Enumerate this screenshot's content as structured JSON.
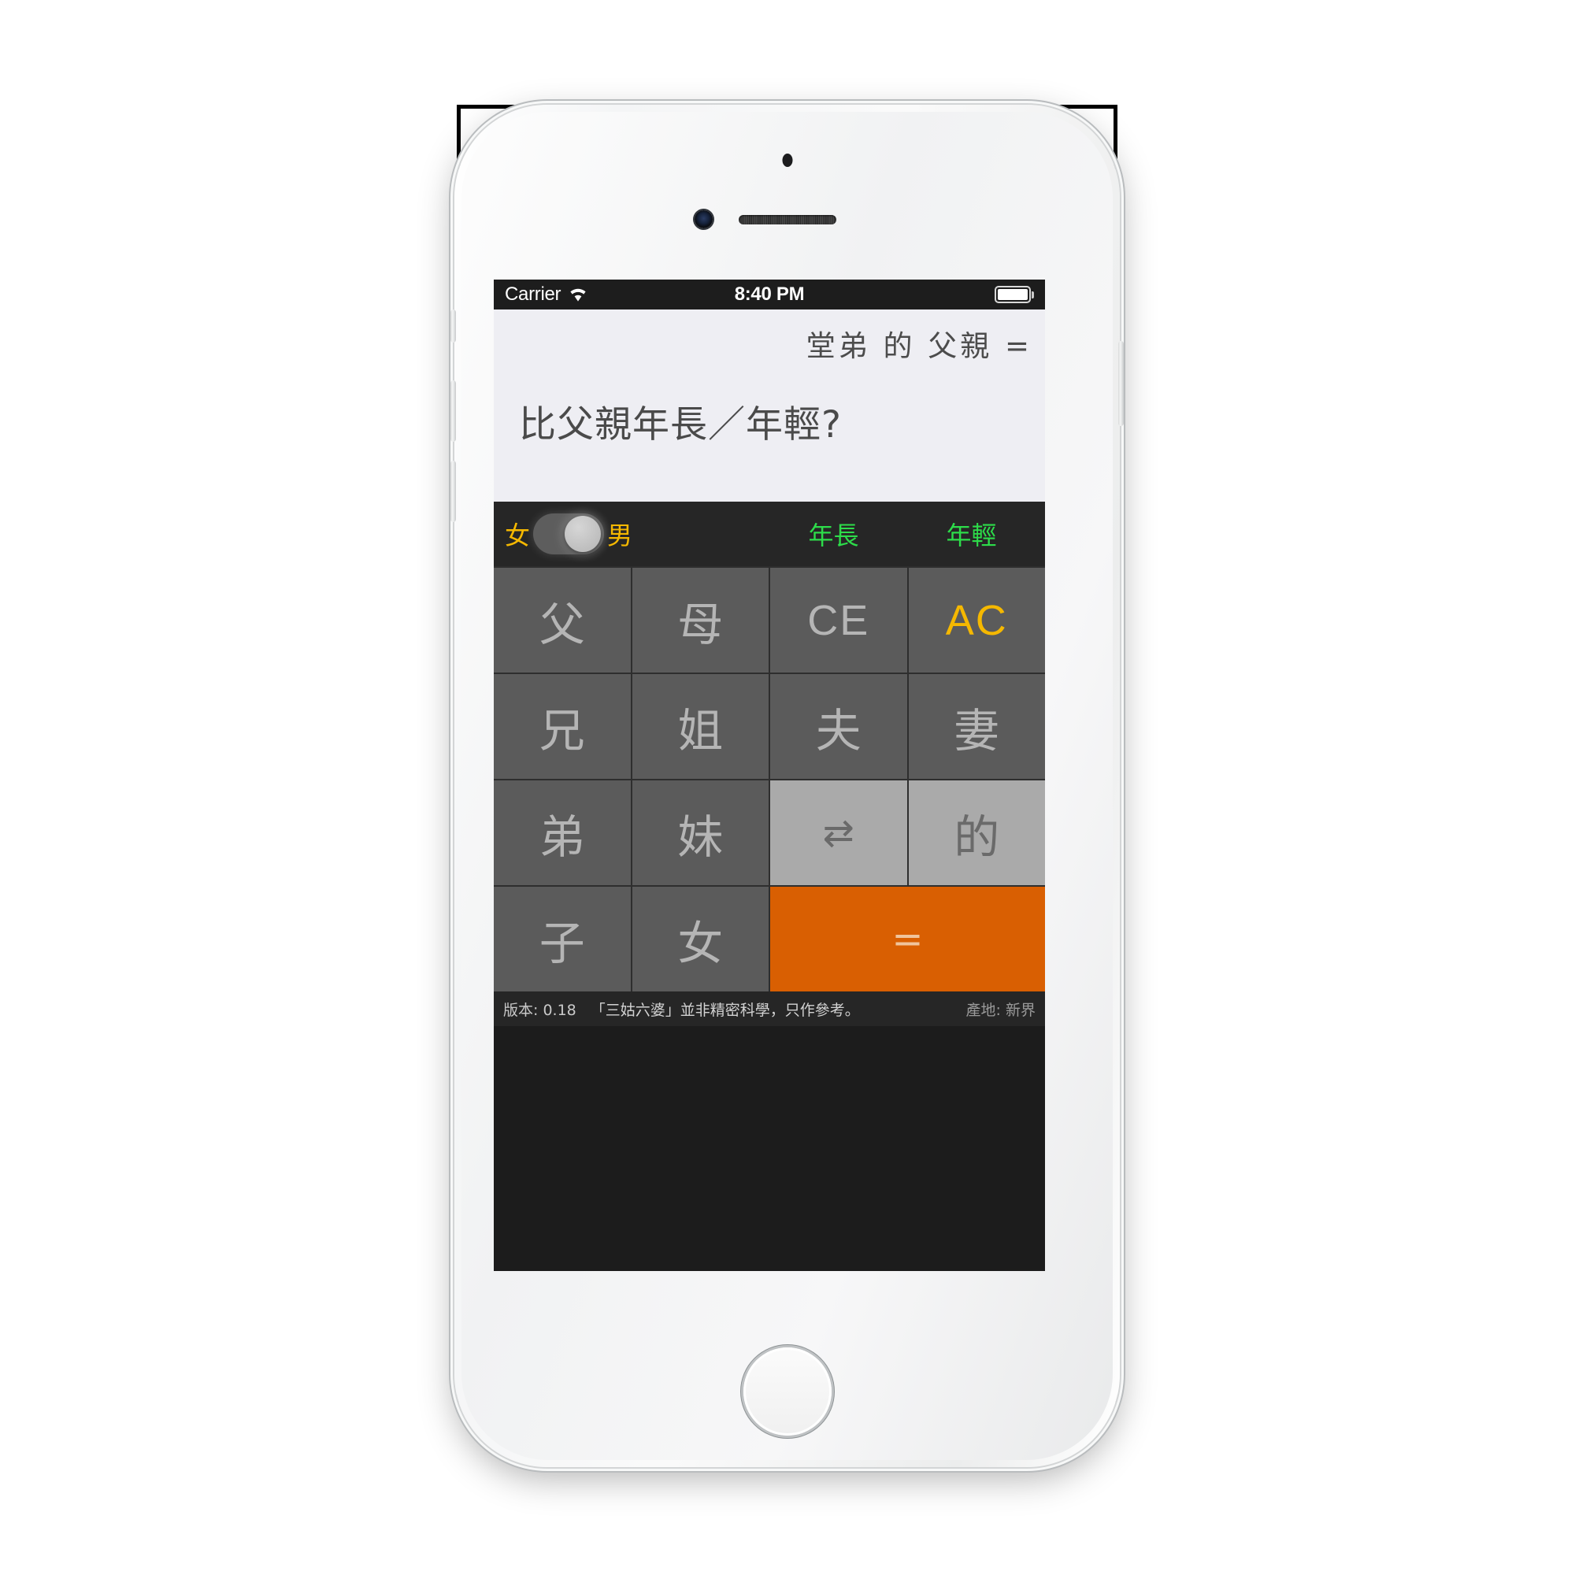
{
  "status_bar": {
    "carrier": "Carrier",
    "wifi_icon": "wifi-icon",
    "time": "8:40 PM",
    "battery_icon": "battery-full-icon"
  },
  "display": {
    "expression": "堂弟 的 父親 =",
    "result": "比父親年長／年輕?"
  },
  "toolbar": {
    "gender_left_label": "女",
    "gender_right_label": "男",
    "gender_toggle_state": "male",
    "older_label": "年長",
    "younger_label": "年輕"
  },
  "keypad": {
    "keys": [
      {
        "label": "父",
        "style": "dark",
        "name": "key-father"
      },
      {
        "label": "母",
        "style": "dark",
        "name": "key-mother"
      },
      {
        "label": "CE",
        "style": "dark",
        "name": "key-clear-entry"
      },
      {
        "label": "AC",
        "style": "accent",
        "name": "key-all-clear"
      },
      {
        "label": "兄",
        "style": "dark",
        "name": "key-elder-brother"
      },
      {
        "label": "姐",
        "style": "dark",
        "name": "key-elder-sister"
      },
      {
        "label": "夫",
        "style": "dark",
        "name": "key-husband"
      },
      {
        "label": "妻",
        "style": "dark",
        "name": "key-wife"
      },
      {
        "label": "弟",
        "style": "dark",
        "name": "key-younger-brother"
      },
      {
        "label": "妹",
        "style": "dark",
        "name": "key-younger-sister"
      },
      {
        "label": "⇄",
        "style": "light",
        "name": "key-swap"
      },
      {
        "label": "的",
        "style": "light",
        "name": "key-possessive"
      },
      {
        "label": "子",
        "style": "dark",
        "name": "key-son"
      },
      {
        "label": "女",
        "style": "dark",
        "name": "key-daughter"
      },
      {
        "label": "=",
        "style": "orange",
        "name": "key-equals"
      }
    ]
  },
  "footer": {
    "version": "版本: 0.18",
    "note": "「三姑六婆」並非精密科學，只作參考。",
    "origin": "產地: 新界"
  },
  "colors": {
    "accent_orange": "#d95f02",
    "accent_yellow": "#f5b800",
    "accent_green": "#2ddc4a",
    "key_dark": "#5b5b5b",
    "key_light": "#aaaaaa",
    "toolbar_bg": "#262626",
    "display_bg": "#eeeef3"
  }
}
